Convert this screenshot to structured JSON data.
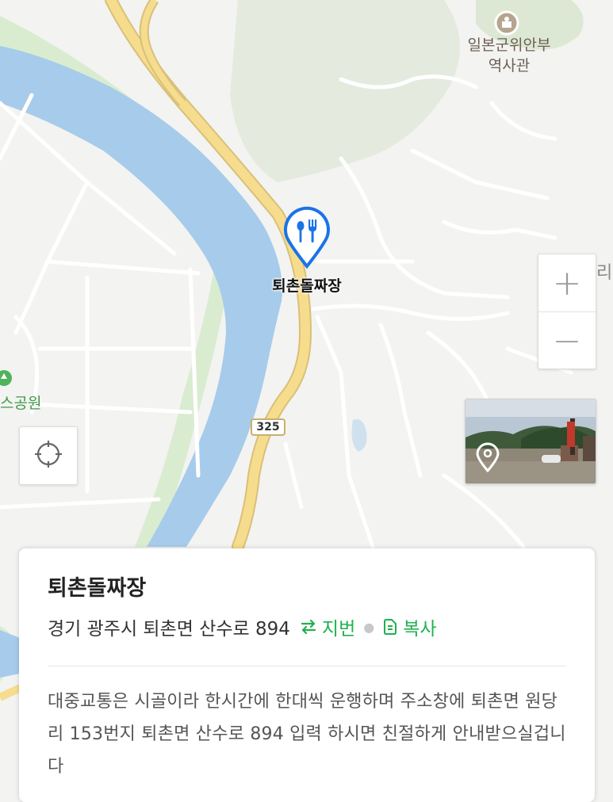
{
  "map": {
    "poi": {
      "name_line1": "일본군위안부",
      "name_line2": "역사관",
      "icon": "landmark-icon"
    },
    "park_label": "스공원",
    "partial_label": "리",
    "route_number": "325",
    "place_marker": {
      "name": "퇴촌돌짜장",
      "icon": "restaurant-pin-icon",
      "color": "#1a73e8"
    },
    "colors": {
      "river": "#a7cbea",
      "road_main": "#f6dc8d",
      "green": "#dfeed8",
      "forest": "#e3e9dd"
    }
  },
  "controls": {
    "zoom_in": "+",
    "zoom_out": "−",
    "locate_icon": "crosshair-icon",
    "streetview_icon": "location-pin-icon"
  },
  "card": {
    "title": "퇴촌돌짜장",
    "address": "경기 광주시 퇴촌면 산수로 894",
    "jibun_label": "지번",
    "jibun_icon": "swap-arrows-icon",
    "copy_label": "복사",
    "copy_icon": "copy-icon",
    "accent_color": "#1fb14f",
    "description": "대중교통은 시골이라 한시간에 한대씩 운행하며 주소창에 퇴촌면 원당리 153번지 퇴촌면 산수로 894 입력 하시면 친절하게 안내받으실겁니다"
  }
}
